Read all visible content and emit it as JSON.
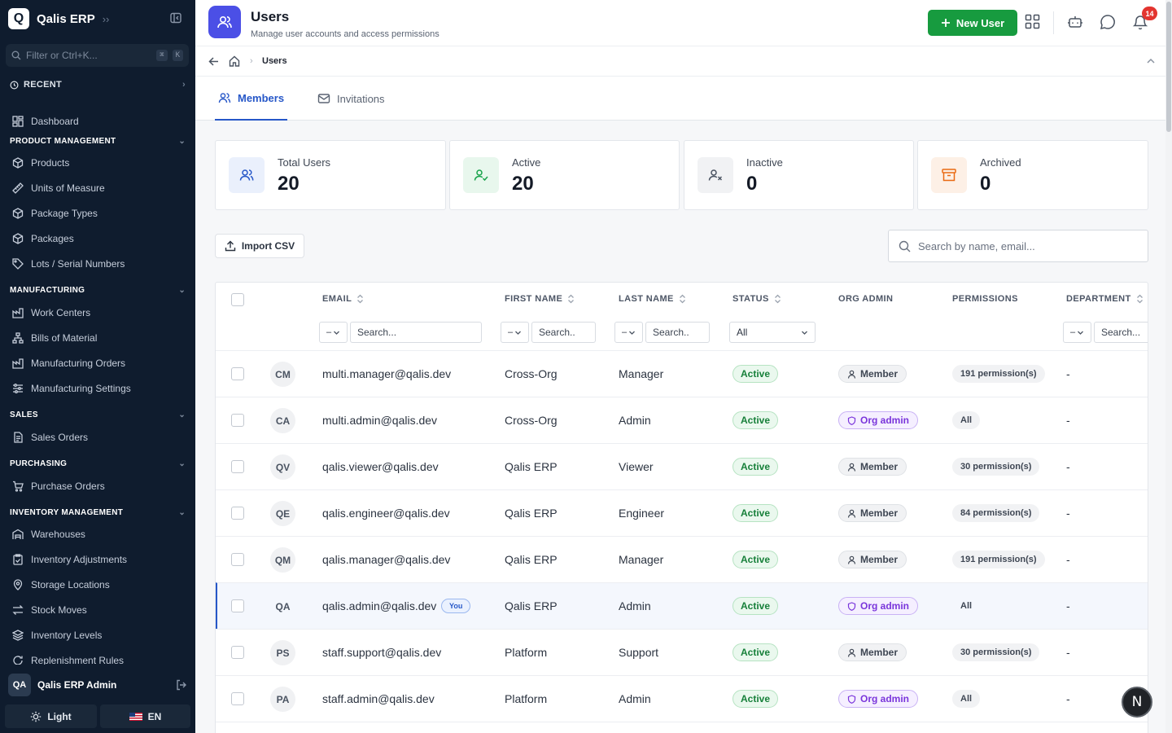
{
  "sidebar": {
    "brand": {
      "logo_letter": "Q",
      "name": "Qalis ERP",
      "chevron": "››"
    },
    "filter": {
      "placeholder": "Filter or Ctrl+K...",
      "kbd1": "⌘",
      "kbd2": "K"
    },
    "recent": {
      "label": "RECENT"
    },
    "dashboard": {
      "label": "Dashboard"
    },
    "sections": {
      "product_management": {
        "label": "PRODUCT MANAGEMENT",
        "items": [
          "Products",
          "Units of Measure",
          "Package Types",
          "Packages",
          "Lots / Serial Numbers"
        ]
      },
      "manufacturing": {
        "label": "MANUFACTURING",
        "items": [
          "Work Centers",
          "Bills of Material",
          "Manufacturing Orders",
          "Manufacturing Settings"
        ]
      },
      "sales": {
        "label": "SALES",
        "items": [
          "Sales Orders"
        ]
      },
      "purchasing": {
        "label": "PURCHASING",
        "items": [
          "Purchase Orders"
        ]
      },
      "inventory_management": {
        "label": "INVENTORY MANAGEMENT",
        "items": [
          "Warehouses",
          "Inventory Adjustments",
          "Storage Locations",
          "Stock Moves",
          "Inventory Levels",
          "Replenishment Rules"
        ]
      }
    },
    "user": {
      "initials": "QA",
      "name": "Qalis ERP Admin"
    },
    "theme_label": "Light",
    "language_label": "EN"
  },
  "header": {
    "title": "Users",
    "subtitle": "Manage user accounts and access permissions",
    "new_user_label": "New User",
    "notification_count": "14"
  },
  "breadcrumb": {
    "current": "Users"
  },
  "tabs": [
    {
      "label": "Members",
      "active": true
    },
    {
      "label": "Invitations",
      "active": false
    }
  ],
  "stats": [
    {
      "label": "Total Users",
      "value": "20",
      "color": "#2657c8"
    },
    {
      "label": "Active",
      "value": "20",
      "color": "#17a34a"
    },
    {
      "label": "Inactive",
      "value": "0",
      "color": "#4a5361"
    },
    {
      "label": "Archived",
      "value": "0",
      "color": "#ea6a12"
    }
  ],
  "toolbar": {
    "import_label": "Import CSV",
    "search_placeholder": "Search by name, email..."
  },
  "table": {
    "columns": [
      "EMAIL",
      "FIRST NAME",
      "LAST NAME",
      "STATUS",
      "ORG ADMIN",
      "PERMISSIONS",
      "DEPARTMENT"
    ],
    "filters": {
      "email_op": "–",
      "email_placeholder": "Search...",
      "first_op": "–",
      "first_placeholder": "Search..",
      "last_op": "–",
      "last_placeholder": "Search..",
      "status_value": "All",
      "dept_op": "–",
      "dept_placeholder": "Search..."
    },
    "you_label": "You",
    "rows": [
      {
        "initials": "CM",
        "email": "multi.manager@qalis.dev",
        "first": "Cross-Org",
        "last": "Manager",
        "status": "Active",
        "role": "Member",
        "permissions": "191 permission(s)",
        "department": "-"
      },
      {
        "initials": "CA",
        "email": "multi.admin@qalis.dev",
        "first": "Cross-Org",
        "last": "Admin",
        "status": "Active",
        "role": "Org admin",
        "permissions": "All",
        "department": "-"
      },
      {
        "initials": "QV",
        "email": "qalis.viewer@qalis.dev",
        "first": "Qalis ERP",
        "last": "Viewer",
        "status": "Active",
        "role": "Member",
        "permissions": "30 permission(s)",
        "department": "-"
      },
      {
        "initials": "QE",
        "email": "qalis.engineer@qalis.dev",
        "first": "Qalis ERP",
        "last": "Engineer",
        "status": "Active",
        "role": "Member",
        "permissions": "84 permission(s)",
        "department": "-"
      },
      {
        "initials": "QM",
        "email": "qalis.manager@qalis.dev",
        "first": "Qalis ERP",
        "last": "Manager",
        "status": "Active",
        "role": "Member",
        "permissions": "191 permission(s)",
        "department": "-"
      },
      {
        "initials": "QA",
        "email": "qalis.admin@qalis.dev",
        "first": "Qalis ERP",
        "last": "Admin",
        "status": "Active",
        "role": "Org admin",
        "permissions": "All",
        "department": "-",
        "you": true
      },
      {
        "initials": "PS",
        "email": "staff.support@qalis.dev",
        "first": "Platform",
        "last": "Support",
        "status": "Active",
        "role": "Member",
        "permissions": "30 permission(s)",
        "department": "-"
      },
      {
        "initials": "PA",
        "email": "staff.admin@qalis.dev",
        "first": "Platform",
        "last": "Admin",
        "status": "Active",
        "role": "Org admin",
        "permissions": "All",
        "department": "-"
      }
    ]
  },
  "fab_letter": "N"
}
